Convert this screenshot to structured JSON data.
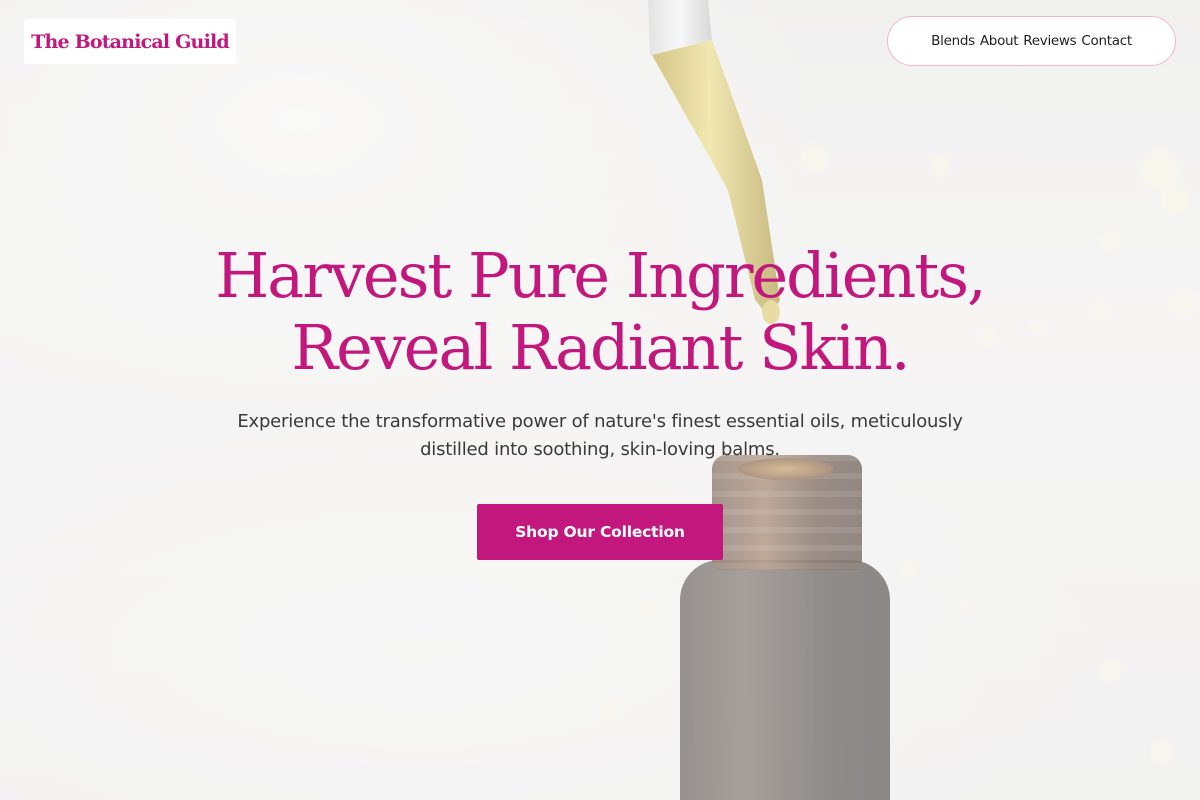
{
  "header": {
    "logo": "The Botanical Guild",
    "nav": [
      "Blends",
      "About",
      "Reviews",
      "Contact"
    ]
  },
  "hero": {
    "headline_line1": "Harvest Pure Ingredients,",
    "headline_line2": "Reveal Radiant Skin.",
    "subtitle_line1": "Experience the transformative power of nature's finest essential oils, meticulously",
    "subtitle_line2": "distilled into soothing, skin-loving balms.",
    "cta": "Shop Our Collection"
  },
  "colors": {
    "brand": "#c2187d",
    "nav_border": "#efb6d2",
    "text": "#3a3a3a"
  }
}
